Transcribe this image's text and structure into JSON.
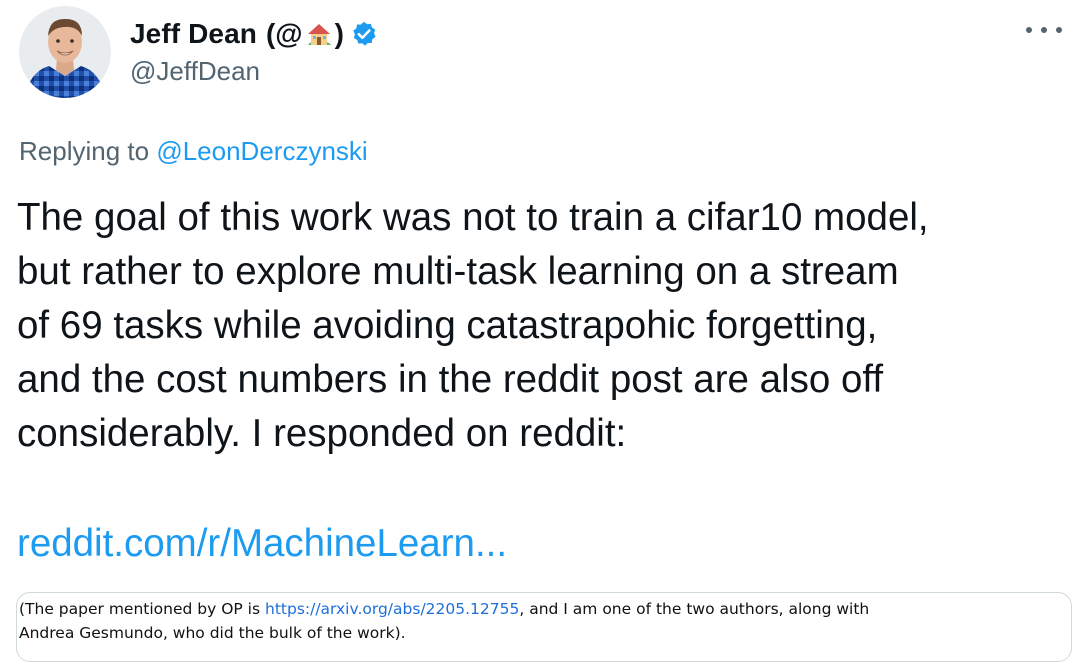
{
  "author": {
    "display_name": "Jeff Dean",
    "name_open": "(@",
    "name_close": ")",
    "handle": "@JeffDean",
    "emoji_icon": "house-with-garden-icon",
    "verified_icon": "verified-badge-icon"
  },
  "menu": {
    "icon": "more-options-icon"
  },
  "reply": {
    "prefix": "Replying to ",
    "to": "@LeonDerczynski"
  },
  "tweet": {
    "text": "The goal of this work was not to train a cifar10 model,\nbut rather to explore multi-task learning on a stream\nof 69 tasks while avoiding catastrapohic forgetting,\nand the cost numbers in the reddit post are also off\nconsiderably.  I responded on reddit:",
    "link": "reddit.com/r/MachineLearn..."
  },
  "card": {
    "text_before": "(The paper mentioned by OP is ",
    "link": "https://arxiv.org/abs/2205.12755",
    "text_after": ", and I am one of the two authors, along with",
    "line2": "Andrea Gesmundo, who did the bulk of the work)."
  },
  "colors": {
    "link": "#1d9bf0",
    "secondary_text": "#536471",
    "primary_text": "#0f1419",
    "verified": "#1d9bf0"
  }
}
